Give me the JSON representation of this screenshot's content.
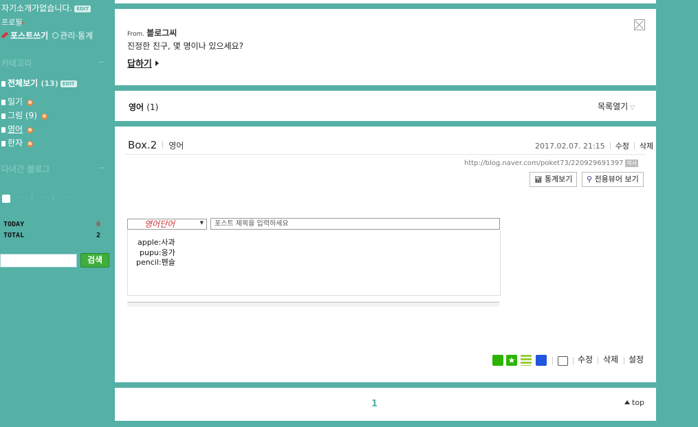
{
  "sidebar": {
    "intro": "자기소개가없습니다.",
    "edit_badge": "EDIT",
    "profile": "프로필",
    "write_post": "포스트쓰기",
    "admin_stats": "관리·통계",
    "category_title": "카테고리",
    "categories": [
      {
        "label": "전체보기",
        "count": "(13)",
        "badge": "EDIT"
      },
      {
        "label": "일기",
        "count": "",
        "badge": "N"
      },
      {
        "label": "그림",
        "count": "(9)",
        "badge": "N"
      },
      {
        "label": "영어",
        "count": "",
        "badge": "N"
      },
      {
        "label": "한자",
        "count": "",
        "badge": "N"
      }
    ],
    "visited_blogs_title": "다녀간 블로그",
    "today_label": "TODAY",
    "today_value": "0",
    "total_label": "TOTAL",
    "total_value": "2",
    "search_button": "검색"
  },
  "question_card": {
    "from_label": "From.",
    "from_name": "블로그씨",
    "question": "진정한 친구, 몇 명이나 있으세요?",
    "reply_label": "답하기"
  },
  "category_bar": {
    "name": "영어",
    "count": "(1)",
    "list_open": "목록열기"
  },
  "post": {
    "title": "Box.2",
    "category": "영어",
    "date": "2017.02.07. 21:15",
    "edit": "수정",
    "delete": "삭제",
    "url": "http://blog.naver.com/poket73/220929691397",
    "copy_badge": "복사",
    "stats_button": "통계보기",
    "viewer_button": "전용뷰어 보기",
    "editor": {
      "handwriting": "영어단어",
      "title_placeholder": "포스트 제목을 입력하세요",
      "lines": [
        "apple:사과",
        "pupu:응가",
        "pencil:펜슬"
      ]
    },
    "footer_edit": "수정",
    "footer_delete": "삭제",
    "footer_settings": "설정"
  },
  "pagination": {
    "current": "1",
    "top_label": "top"
  },
  "colors": {
    "background": "#55b0a6",
    "search_button": "#3fae3b",
    "new_badge": "#e58a40"
  }
}
